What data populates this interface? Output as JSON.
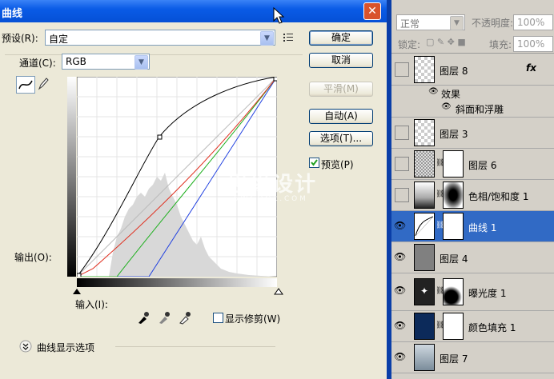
{
  "dialog": {
    "title": "曲线",
    "preset_label": "预设(R):",
    "preset_value": "自定",
    "channel_label": "通道(C):",
    "channel_value": "RGB",
    "output_label": "输出(O):",
    "input_label": "输入(I):",
    "show_clipping_label": "显示修剪(W)",
    "curve_display_options": "曲线显示选项",
    "preview_label": "预览(P)",
    "preview_checked": true,
    "buttons": {
      "ok": "确定",
      "cancel": "取消",
      "smooth": "平滑(M)",
      "auto": "自动(A)",
      "options": "选项(T)..."
    }
  },
  "watermark": {
    "line1": "思缘设计",
    "line2": "5 W C O O L . C O M"
  },
  "layers_panel": {
    "blend_mode": "正常",
    "opacity_label": "不透明度:",
    "opacity_value": "100%",
    "lock_label": "锁定:",
    "fill_label": "填充:",
    "fill_value": "100%",
    "layers": [
      {
        "name": "图层 8",
        "visible": false,
        "fx": "fx",
        "selected": false
      },
      {
        "name": "效果",
        "is_effect_header": true
      },
      {
        "name": "斜面和浮雕",
        "is_effect": true
      },
      {
        "name": "图层 3",
        "visible": false,
        "selected": false
      },
      {
        "name": "图层 6",
        "visible": false,
        "selected": false
      },
      {
        "name": "色相/饱和度 1",
        "visible": false,
        "selected": false
      },
      {
        "name": "曲线 1",
        "visible": true,
        "selected": true
      },
      {
        "name": "图层 4",
        "visible": true,
        "selected": false
      },
      {
        "name": "曝光度 1",
        "visible": true,
        "selected": false
      },
      {
        "name": "颜色填充 1",
        "visible": true,
        "selected": false
      },
      {
        "name": "图层 7",
        "visible": true,
        "selected": false
      }
    ]
  },
  "colors": {
    "titlebar": "#0550d6",
    "selected_layer": "#316ac5",
    "curve_red": "#e03020",
    "curve_green": "#20b020",
    "curve_blue": "#2040e0"
  }
}
